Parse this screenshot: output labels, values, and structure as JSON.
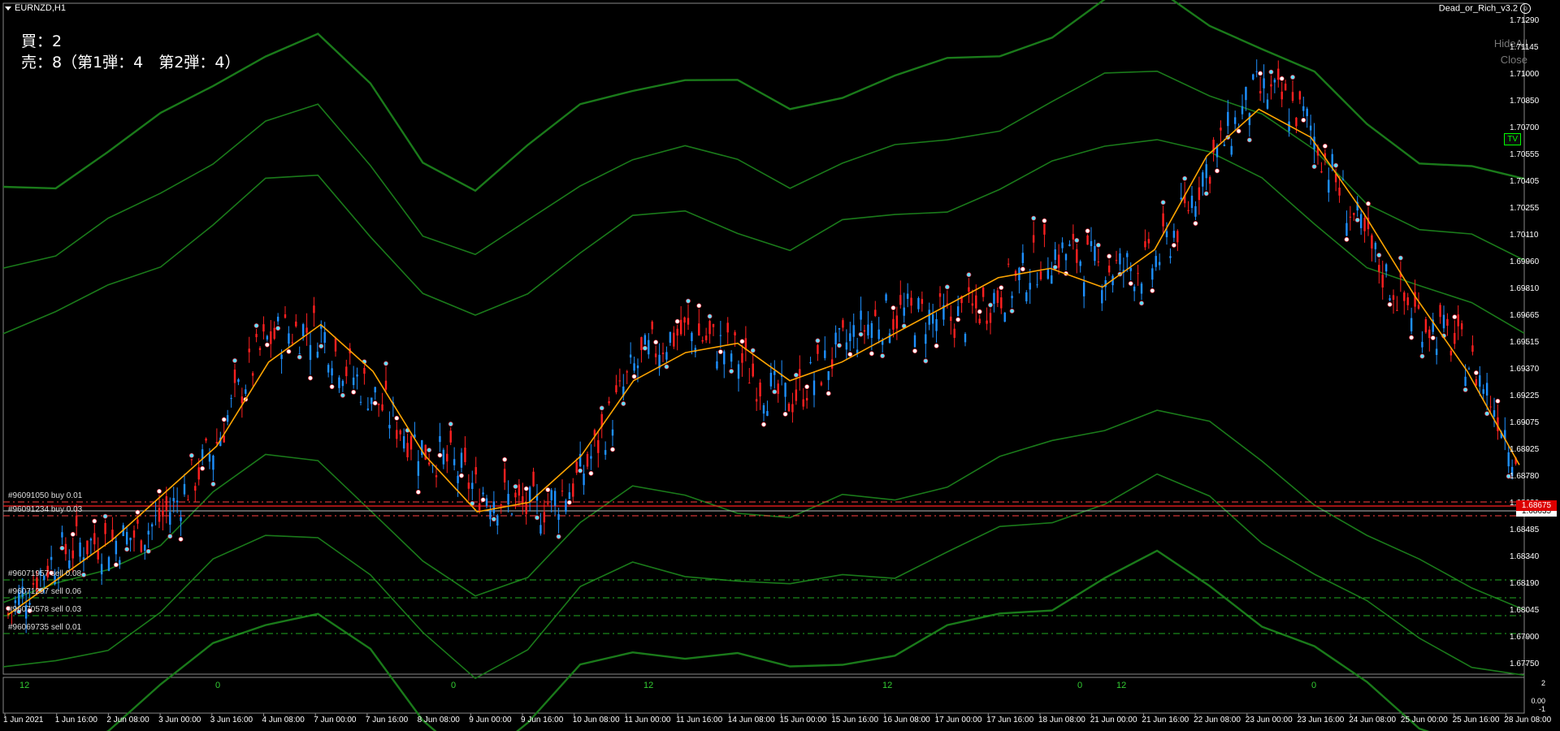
{
  "window": {
    "symbol": "EURNZD,H1",
    "expert_name": "Dead_or_Rich_v3.2",
    "expert_icon": "smiley-icon"
  },
  "positions": {
    "buy_line": "買：2",
    "sell_line": "売：8（第1弾：4　第2弾：4）"
  },
  "buttons": {
    "hide_all": "HideAll",
    "close": "Close"
  },
  "tv_badge": "TV",
  "price_axis": {
    "ticks": [
      "1.71290",
      "1.71145",
      "1.71000",
      "1.70850",
      "1.70700",
      "1.70555",
      "1.70405",
      "1.70255",
      "1.70110",
      "1.69960",
      "1.69810",
      "1.69665",
      "1.69515",
      "1.69370",
      "1.69225",
      "1.69075",
      "1.68925",
      "1.68780",
      "1.68630",
      "1.68485",
      "1.68340",
      "1.68190",
      "1.68045",
      "1.67900",
      "1.67750"
    ],
    "current_price": "1.68635",
    "ask_price": "1.68675"
  },
  "orders": [
    {
      "label": "#96091050 buy 0.01",
      "color": "#ff4040"
    },
    {
      "label": "#96091234 buy 0.03",
      "color": "#ff4040"
    },
    {
      "label": "#96071957 sell 0.08",
      "color": "#22aa22"
    },
    {
      "label": "#96071297 sell 0.06",
      "color": "#22aa22"
    },
    {
      "label": "#96070578 sell 0.03",
      "color": "#22aa22"
    },
    {
      "label": "#96069735 sell 0.01",
      "color": "#22aa22"
    }
  ],
  "time_axis": [
    "1 Jun 2021",
    "1 Jun 16:00",
    "2 Jun 08:00",
    "3 Jun 00:00",
    "3 Jun 16:00",
    "4 Jun 08:00",
    "7 Jun 00:00",
    "7 Jun 16:00",
    "8 Jun 08:00",
    "9 Jun 00:00",
    "9 Jun 16:00",
    "10 Jun 08:00",
    "11 Jun 00:00",
    "11 Jun 16:00",
    "14 Jun 08:00",
    "15 Jun 00:00",
    "15 Jun 16:00",
    "16 Jun 08:00",
    "17 Jun 00:00",
    "17 Jun 16:00",
    "18 Jun 08:00",
    "21 Jun 00:00",
    "21 Jun 16:00",
    "22 Jun 08:00",
    "23 Jun 00:00",
    "23 Jun 16:00",
    "24 Jun 08:00",
    "25 Jun 00:00",
    "25 Jun 16:00",
    "28 Jun 08:00"
  ],
  "subwindow": {
    "hour_labels": [
      "12",
      "0",
      "0",
      "12",
      "12",
      "0",
      "12",
      "0"
    ],
    "scale": [
      "2",
      "0.00",
      "-1"
    ]
  },
  "colors": {
    "up_candle": "#1e90ff",
    "down_candle": "#ff2020",
    "bands": "#1a7a1a",
    "ma": "#ffa500",
    "order_buy": "#ff4040",
    "order_sell": "#22aa22"
  },
  "chart_data": {
    "type": "candlestick",
    "ylim": [
      1.6775,
      1.7129
    ],
    "ma_path": [
      1.6805,
      1.6825,
      1.6845,
      1.687,
      1.6895,
      1.694,
      1.696,
      1.6935,
      1.689,
      1.686,
      1.6865,
      1.689,
      1.693,
      1.6945,
      1.695,
      1.693,
      1.694,
      1.6955,
      1.697,
      1.6985,
      1.699,
      1.698,
      1.7,
      1.705,
      1.7075,
      1.706,
      1.702,
      1.6975,
      1.6935,
      1.6885
    ]
  }
}
